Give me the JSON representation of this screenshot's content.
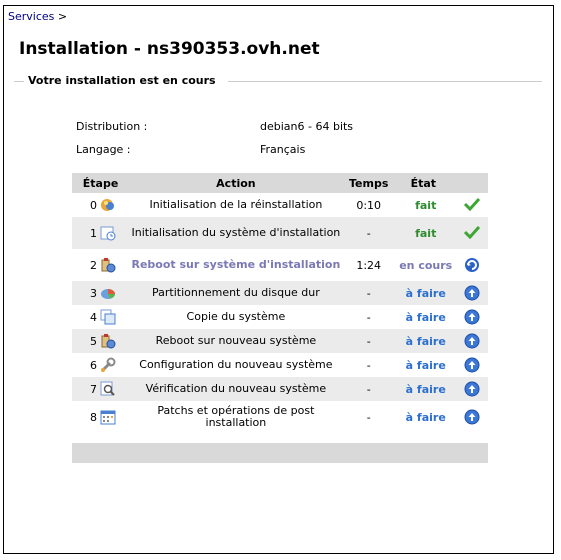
{
  "breadcrumb": {
    "link": "Services",
    "separator": ">"
  },
  "title": "Installation - ns390353.ovh.net",
  "section_title": "Votre installation est en cours",
  "info": {
    "distribution_label": "Distribution :",
    "distribution_value": "debian6 - 64 bits",
    "language_label": "Langage :",
    "language_value": "Français"
  },
  "table": {
    "headers": {
      "step": "Étape",
      "action": "Action",
      "time": "Temps",
      "state": "État"
    },
    "rows": [
      {
        "num": "0",
        "icon": "restore-icon",
        "action": "Initialisation de la réinstallation",
        "time": "0:10",
        "state": "fait",
        "state_icon": "check-icon"
      },
      {
        "num": "1",
        "icon": "system-init-icon",
        "action": "Initialisation du système d'installation",
        "time": "-",
        "state": "fait",
        "state_icon": "check-icon"
      },
      {
        "num": "2",
        "icon": "reboot-icon",
        "action": "Reboot sur système d'installation",
        "time": "1:24",
        "state": "en cours",
        "state_icon": "spinner-icon"
      },
      {
        "num": "3",
        "icon": "disk-partition-icon",
        "action": "Partitionnement du disque dur",
        "time": "-",
        "state": "à faire",
        "state_icon": "arrow-up-circle-icon"
      },
      {
        "num": "4",
        "icon": "copy-system-icon",
        "action": "Copie du système",
        "time": "-",
        "state": "à faire",
        "state_icon": "arrow-up-circle-icon"
      },
      {
        "num": "5",
        "icon": "reboot-icon",
        "action": "Reboot sur nouveau système",
        "time": "-",
        "state": "à faire",
        "state_icon": "arrow-up-circle-icon"
      },
      {
        "num": "6",
        "icon": "wrench-icon",
        "action": "Configuration du nouveau système",
        "time": "-",
        "state": "à faire",
        "state_icon": "arrow-up-circle-icon"
      },
      {
        "num": "7",
        "icon": "verify-icon",
        "action": "Vérification du nouveau système",
        "time": "-",
        "state": "à faire",
        "state_icon": "arrow-up-circle-icon"
      },
      {
        "num": "8",
        "icon": "patch-calendar-icon",
        "action": "Patchs et opérations de post installation",
        "time": "-",
        "state": "à faire",
        "state_icon": "arrow-up-circle-icon"
      }
    ]
  },
  "colors": {
    "done": "#2e8b2e",
    "running": "#7a79b5",
    "todo": "#2c6fd1",
    "header_bg": "#d9d9d9",
    "row_shade": "#ebebeb"
  }
}
